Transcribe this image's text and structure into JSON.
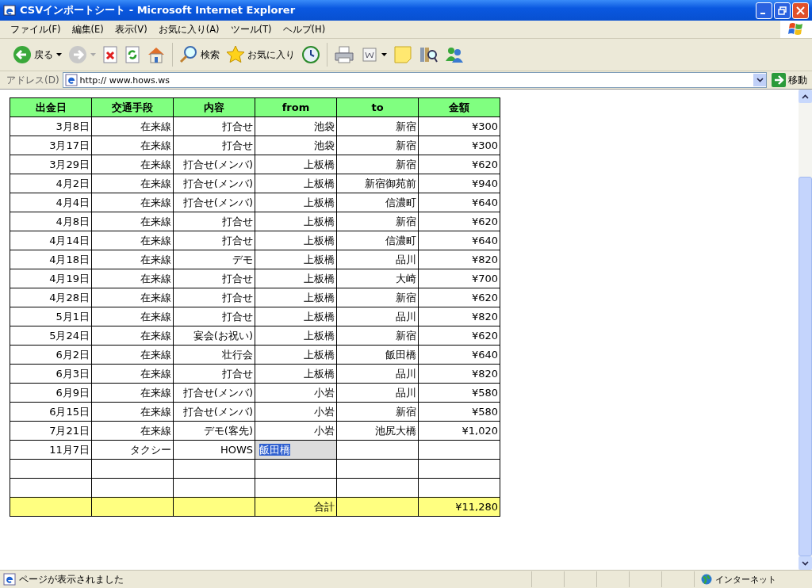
{
  "window": {
    "title": "CSVインポートシート - Microsoft Internet Explorer"
  },
  "menu": [
    "ファイル(F)",
    "編集(E)",
    "表示(V)",
    "お気に入り(A)",
    "ツール(T)",
    "ヘルプ(H)"
  ],
  "toolbar": {
    "back_label": "戻る",
    "search_label": "検索",
    "favorites_label": "お気に入り"
  },
  "address": {
    "label": "アドレス(D)",
    "url": "http:// www.hows.ws",
    "go_label": "移動"
  },
  "table": {
    "columns": [
      "出金日",
      "交通手段",
      "内容",
      "from",
      "to",
      "金額"
    ],
    "rows": [
      {
        "kind": "data",
        "editing": false,
        "date": "3月8日",
        "transport": "在来線",
        "purpose": "打合せ",
        "from": "池袋",
        "to": "新宿",
        "amount": "¥300"
      },
      {
        "kind": "data",
        "editing": false,
        "date": "3月17日",
        "transport": "在来線",
        "purpose": "打合せ",
        "from": "池袋",
        "to": "新宿",
        "amount": "¥300"
      },
      {
        "kind": "data",
        "editing": false,
        "date": "3月29日",
        "transport": "在来線",
        "purpose": "打合せ(メンバ)",
        "from": "上板橋",
        "to": "新宿",
        "amount": "¥620"
      },
      {
        "kind": "data",
        "editing": false,
        "date": "4月2日",
        "transport": "在来線",
        "purpose": "打合せ(メンバ)",
        "from": "上板橋",
        "to": "新宿御苑前",
        "amount": "¥940"
      },
      {
        "kind": "data",
        "editing": false,
        "date": "4月4日",
        "transport": "在来線",
        "purpose": "打合せ(メンバ)",
        "from": "上板橋",
        "to": "信濃町",
        "amount": "¥640"
      },
      {
        "kind": "data",
        "editing": false,
        "date": "4月8日",
        "transport": "在来線",
        "purpose": "打合せ",
        "from": "上板橋",
        "to": "新宿",
        "amount": "¥620"
      },
      {
        "kind": "data",
        "editing": false,
        "date": "4月14日",
        "transport": "在来線",
        "purpose": "打合せ",
        "from": "上板橋",
        "to": "信濃町",
        "amount": "¥640"
      },
      {
        "kind": "data",
        "editing": false,
        "date": "4月18日",
        "transport": "在来線",
        "purpose": "デモ",
        "from": "上板橋",
        "to": "品川",
        "amount": "¥820"
      },
      {
        "kind": "data",
        "editing": false,
        "date": "4月19日",
        "transport": "在来線",
        "purpose": "打合せ",
        "from": "上板橋",
        "to": "大崎",
        "amount": "¥700"
      },
      {
        "kind": "data",
        "editing": false,
        "date": "4月28日",
        "transport": "在来線",
        "purpose": "打合せ",
        "from": "上板橋",
        "to": "新宿",
        "amount": "¥620"
      },
      {
        "kind": "data",
        "editing": false,
        "date": "5月1日",
        "transport": "在来線",
        "purpose": "打合せ",
        "from": "上板橋",
        "to": "品川",
        "amount": "¥820"
      },
      {
        "kind": "data",
        "editing": false,
        "date": "5月24日",
        "transport": "在来線",
        "purpose": "宴会(お祝い)",
        "from": "上板橋",
        "to": "新宿",
        "amount": "¥620"
      },
      {
        "kind": "data",
        "editing": false,
        "date": "6月2日",
        "transport": "在来線",
        "purpose": "壮行会",
        "from": "上板橋",
        "to": "飯田橋",
        "amount": "¥640"
      },
      {
        "kind": "data",
        "editing": false,
        "date": "6月3日",
        "transport": "在来線",
        "purpose": "打合せ",
        "from": "上板橋",
        "to": "品川",
        "amount": "¥820"
      },
      {
        "kind": "data",
        "editing": false,
        "date": "6月9日",
        "transport": "在来線",
        "purpose": "打合せ(メンバ)",
        "from": "小岩",
        "to": "品川",
        "amount": "¥580"
      },
      {
        "kind": "data",
        "editing": false,
        "date": "6月15日",
        "transport": "在来線",
        "purpose": "打合せ(メンバ)",
        "from": "小岩",
        "to": "新宿",
        "amount": "¥580"
      },
      {
        "kind": "data",
        "editing": false,
        "date": "7月21日",
        "transport": "在来線",
        "purpose": "デモ(客先)",
        "from": "小岩",
        "to": "池尻大橋",
        "amount": "¥1,020"
      },
      {
        "kind": "data",
        "editing": true,
        "date": "11月7日",
        "transport": "タクシー",
        "purpose": "HOWS",
        "from": "飯田橋"
      },
      {
        "kind": "blank",
        "editing": false
      },
      {
        "kind": "blank",
        "editing": false
      },
      {
        "kind": "total",
        "editing": false,
        "from": "合計",
        "amount": "¥11,280"
      }
    ]
  },
  "status_bar": {
    "text": "ページが表示されました",
    "zone": "インターネット"
  }
}
